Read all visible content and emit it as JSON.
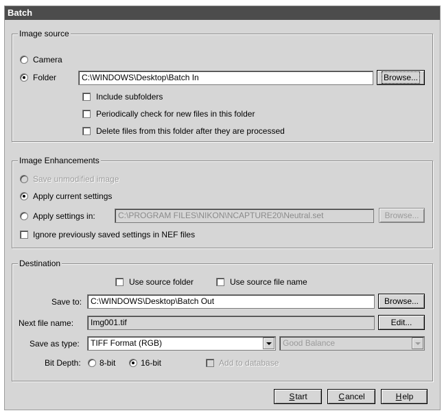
{
  "window": {
    "title": "Batch"
  },
  "image_source": {
    "group_title": "Image source",
    "camera_label": "Camera",
    "folder_label": "Folder",
    "folder_path": "C:\\WINDOWS\\Desktop\\Batch In",
    "browse_label": "Browse...",
    "include_subfolders": "Include subfolders",
    "periodically_check": "Periodically check for new files in this folder",
    "delete_files": "Delete files from this folder after they are processed",
    "selected": "Folder"
  },
  "image_enhancements": {
    "group_title": "Image Enhancements",
    "save_unmodified": "Save unmodified image",
    "apply_current": "Apply current settings",
    "apply_settings_in": "Apply settings in:",
    "settings_path": "C:\\PROGRAM FILES\\NIKON\\NCAPTURE20\\Neutral.set",
    "browse_label": "Browse...",
    "ignore_nef": "Ignore previously saved settings in NEF files",
    "selected": "Apply current settings"
  },
  "destination": {
    "group_title": "Destination",
    "use_source_folder": "Use source folder",
    "use_source_file_name": "Use source file name",
    "save_to_label": "Save to:",
    "save_to_path": "C:\\WINDOWS\\Desktop\\Batch Out",
    "browse_label": "Browse...",
    "next_file_name_label": "Next file name:",
    "next_file_name": "Img001.tif",
    "edit_label": "Edit...",
    "save_as_type_label": "Save as type:",
    "save_as_type_value": "TIFF Format (RGB)",
    "quality_value": "Good Balance",
    "bit_depth_label": "Bit Depth:",
    "bit_8": "8-bit",
    "bit_16": "16-bit",
    "bit_selected": "16-bit",
    "add_to_database": "Add to database"
  },
  "buttons": {
    "start_prefix": "",
    "start_mnemonic": "S",
    "start_rest": "tart",
    "cancel_mnemonic": "C",
    "cancel_rest": "ancel",
    "help_mnemonic": "H",
    "help_rest": "elp"
  }
}
